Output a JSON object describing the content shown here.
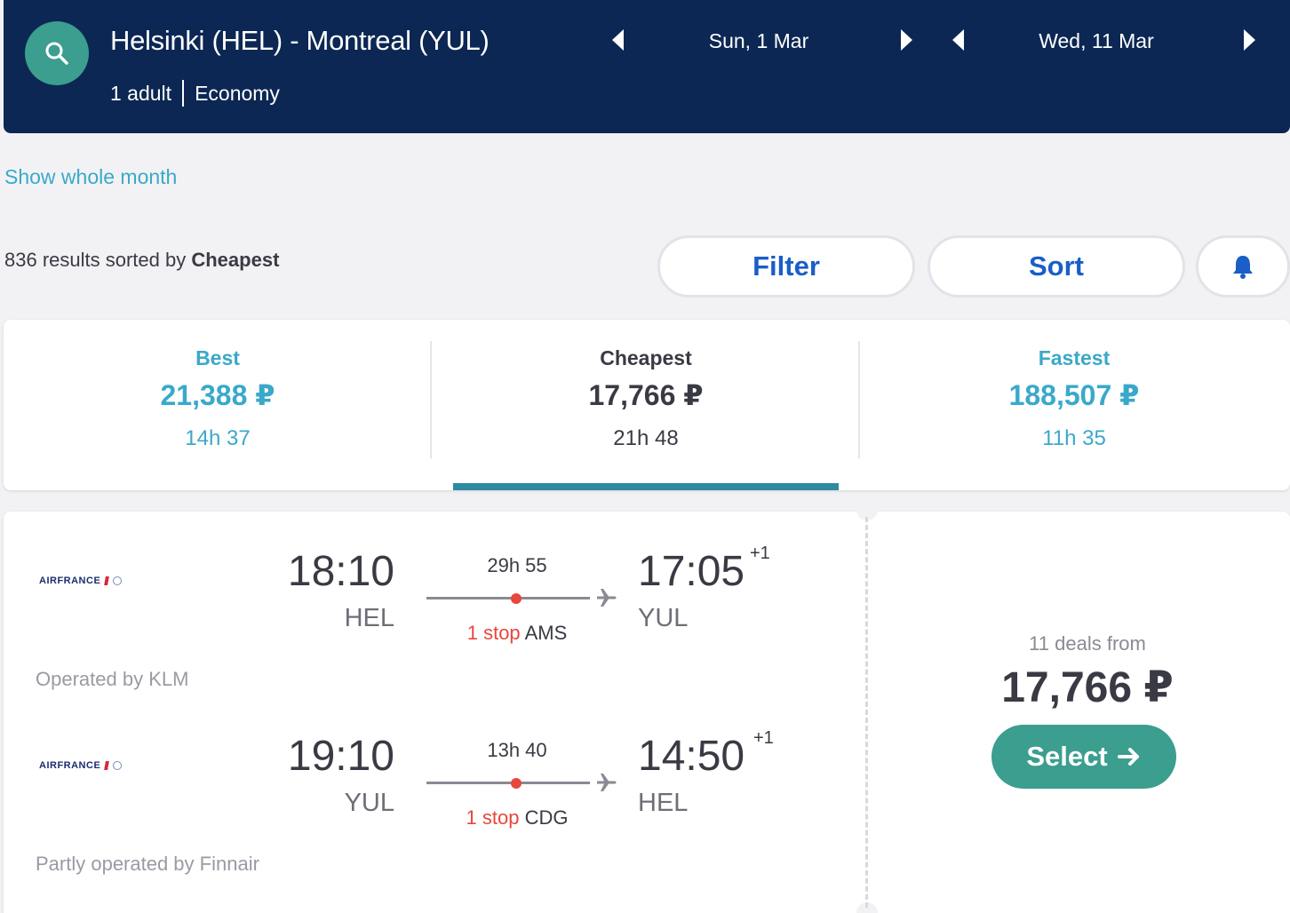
{
  "header": {
    "route": "Helsinki (HEL) - Montreal (YUL)",
    "passengers": "1 adult",
    "cabin": "Economy",
    "outbound_date": "Sun, 1 Mar",
    "return_date": "Wed, 11 Mar"
  },
  "calendar": {
    "show_month_label": "Show whole month"
  },
  "results": {
    "count_text": "836 results sorted by",
    "sort_value": "Cheapest",
    "filter_label": "Filter",
    "sort_label": "Sort"
  },
  "tabs": [
    {
      "label": "Best",
      "price": "21,388 ₽",
      "duration": "14h 37"
    },
    {
      "label": "Cheapest",
      "price": "17,766 ₽",
      "duration": "21h 48"
    },
    {
      "label": "Fastest",
      "price": "188,507 ₽",
      "duration": "11h 35"
    }
  ],
  "itinerary": {
    "legs": [
      {
        "airline_logo_text": "AIRFRANCE",
        "depart_time": "18:10",
        "depart_airport": "HEL",
        "duration": "29h 55",
        "stops": "1 stop",
        "stop_airport": "AMS",
        "arrive_time": "17:05",
        "day_offset": "+1",
        "arrive_airport": "YUL",
        "operated_by": "Operated by KLM"
      },
      {
        "airline_logo_text": "AIRFRANCE",
        "depart_time": "19:10",
        "depart_airport": "YUL",
        "duration": "13h 40",
        "stops": "1 stop",
        "stop_airport": "CDG",
        "arrive_time": "14:50",
        "day_offset": "+1",
        "arrive_airport": "HEL",
        "operated_by": "Partly operated by Finnair"
      }
    ],
    "deals_text": "11 deals from",
    "price": "17,766 ₽",
    "select_label": "Select"
  },
  "icons": {
    "search": "search-icon",
    "prev": "caret-left-icon",
    "next": "caret-right-icon",
    "alert": "bell-icon",
    "plane": "plane-icon",
    "arrow": "arrow-right-icon"
  },
  "colors": {
    "header_bg": "#0c2753",
    "accent_teal": "#3b9e8e",
    "link_blue": "#3aa9c9",
    "button_text_blue": "#1a5ec8",
    "stop_red": "#e8473c"
  }
}
